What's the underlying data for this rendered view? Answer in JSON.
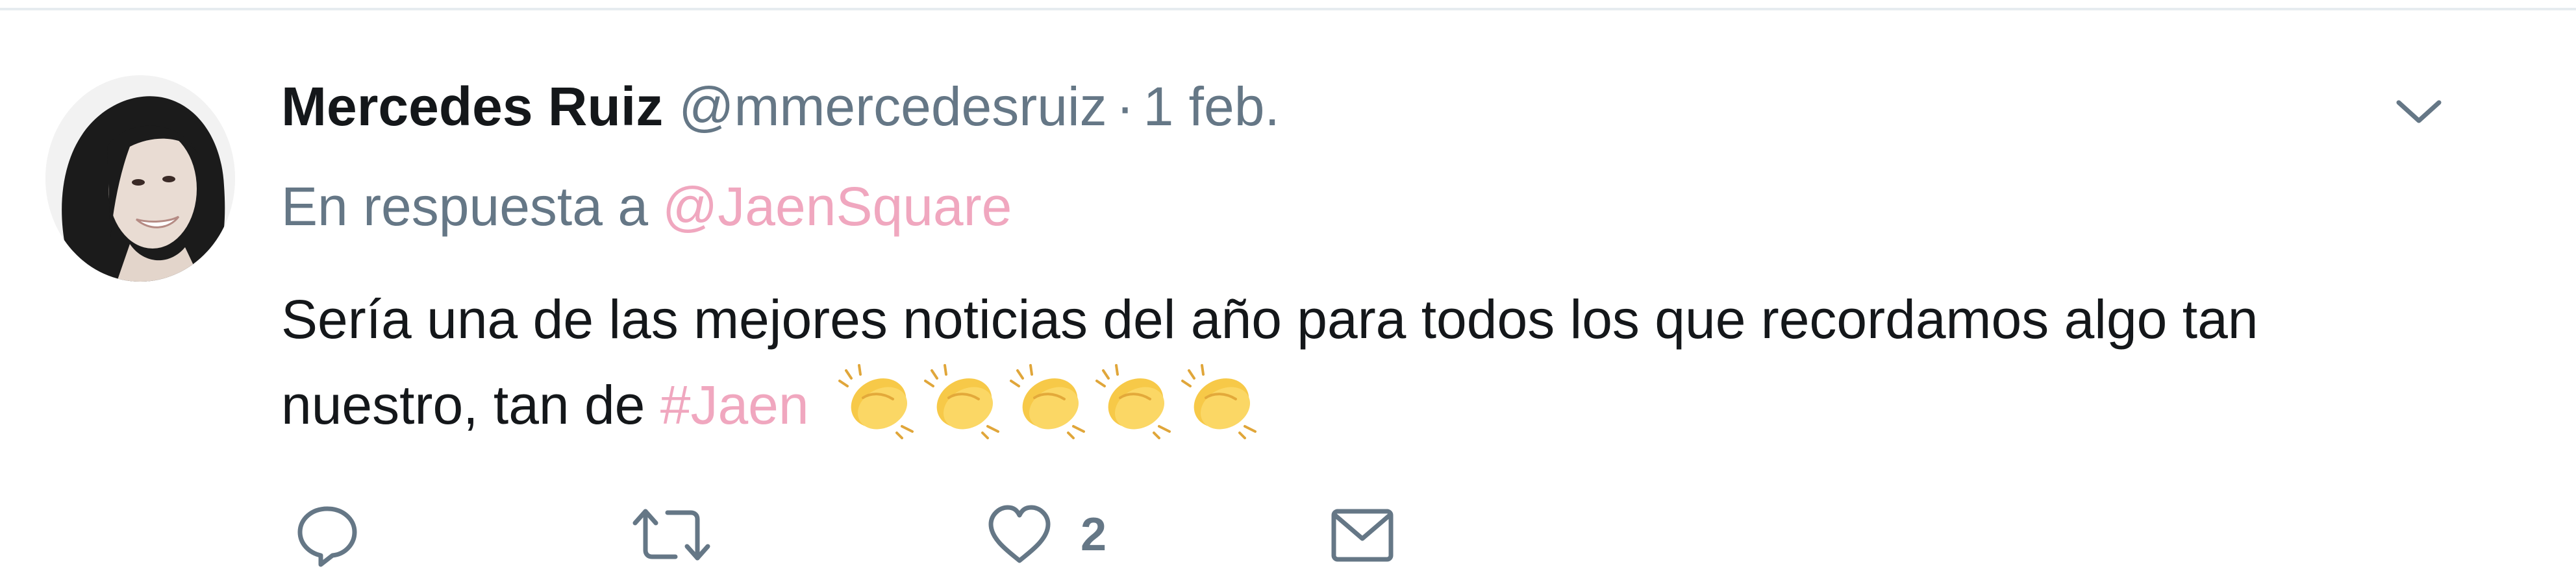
{
  "tweet": {
    "author_name": "Mercedes Ruiz",
    "author_handle": "@mmercedesruiz",
    "separator": "·",
    "timestamp": "1 feb.",
    "reply_prefix": "En respuesta a",
    "reply_mention": "@JaenSquare",
    "text_line1": "Sería una de las mejores noticias del año para todos los que recordamos algo tan",
    "text_line2_prefix": "nuestro, tan de",
    "hashtag": "#Jaen",
    "emojis": [
      "clapping-hands",
      "clapping-hands",
      "clapping-hands",
      "clapping-hands",
      "clapping-hands"
    ],
    "likes_count": "2"
  },
  "actions": {
    "reply_icon": "reply-icon",
    "retweet_icon": "retweet-icon",
    "like_icon": "heart-icon",
    "dm_icon": "envelope-icon",
    "menu_icon": "chevron-down-icon"
  },
  "colors": {
    "link": "#f0a7bf",
    "secondary_text": "#657786",
    "primary_text": "#14171a",
    "divider": "#e6ecf0",
    "emoji_yellow": "#f7c948"
  }
}
